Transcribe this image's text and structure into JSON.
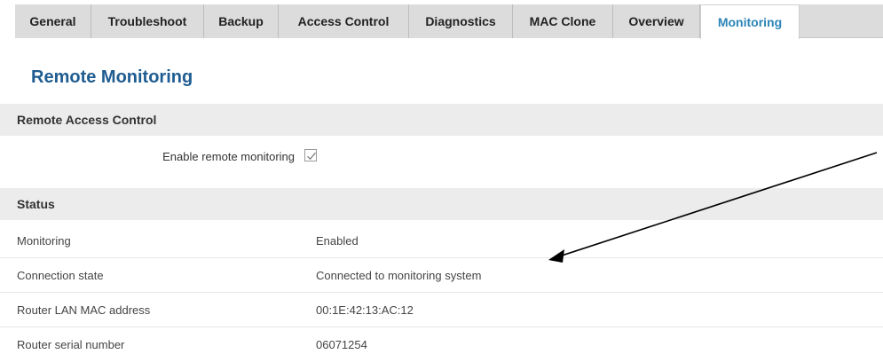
{
  "tabs": [
    {
      "label": "General",
      "active": false
    },
    {
      "label": "Troubleshoot",
      "active": false
    },
    {
      "label": "Backup",
      "active": false
    },
    {
      "label": "Access Control",
      "active": false
    },
    {
      "label": "Diagnostics",
      "active": false
    },
    {
      "label": "MAC Clone",
      "active": false
    },
    {
      "label": "Overview",
      "active": false
    },
    {
      "label": "Monitoring",
      "active": true
    }
  ],
  "page": {
    "title": "Remote Monitoring"
  },
  "remote_access": {
    "header": "Remote Access Control",
    "enable_label": "Enable remote monitoring",
    "enable_checked": true
  },
  "status": {
    "header": "Status",
    "rows": [
      {
        "key": "Monitoring",
        "value": "Enabled"
      },
      {
        "key": "Connection state",
        "value": "Connected to monitoring system"
      },
      {
        "key": "Router LAN MAC address",
        "value": "00:1E:42:13:AC:12"
      },
      {
        "key": "Router serial number",
        "value": "06071254"
      }
    ]
  },
  "colors": {
    "accent": "#2c84b7",
    "title": "#1f5c91",
    "tab_bg": "#dcdcdc",
    "section_bg": "#ececec"
  },
  "icons": {
    "checkbox": "checkmark-icon",
    "annotation": "arrow-icon"
  }
}
